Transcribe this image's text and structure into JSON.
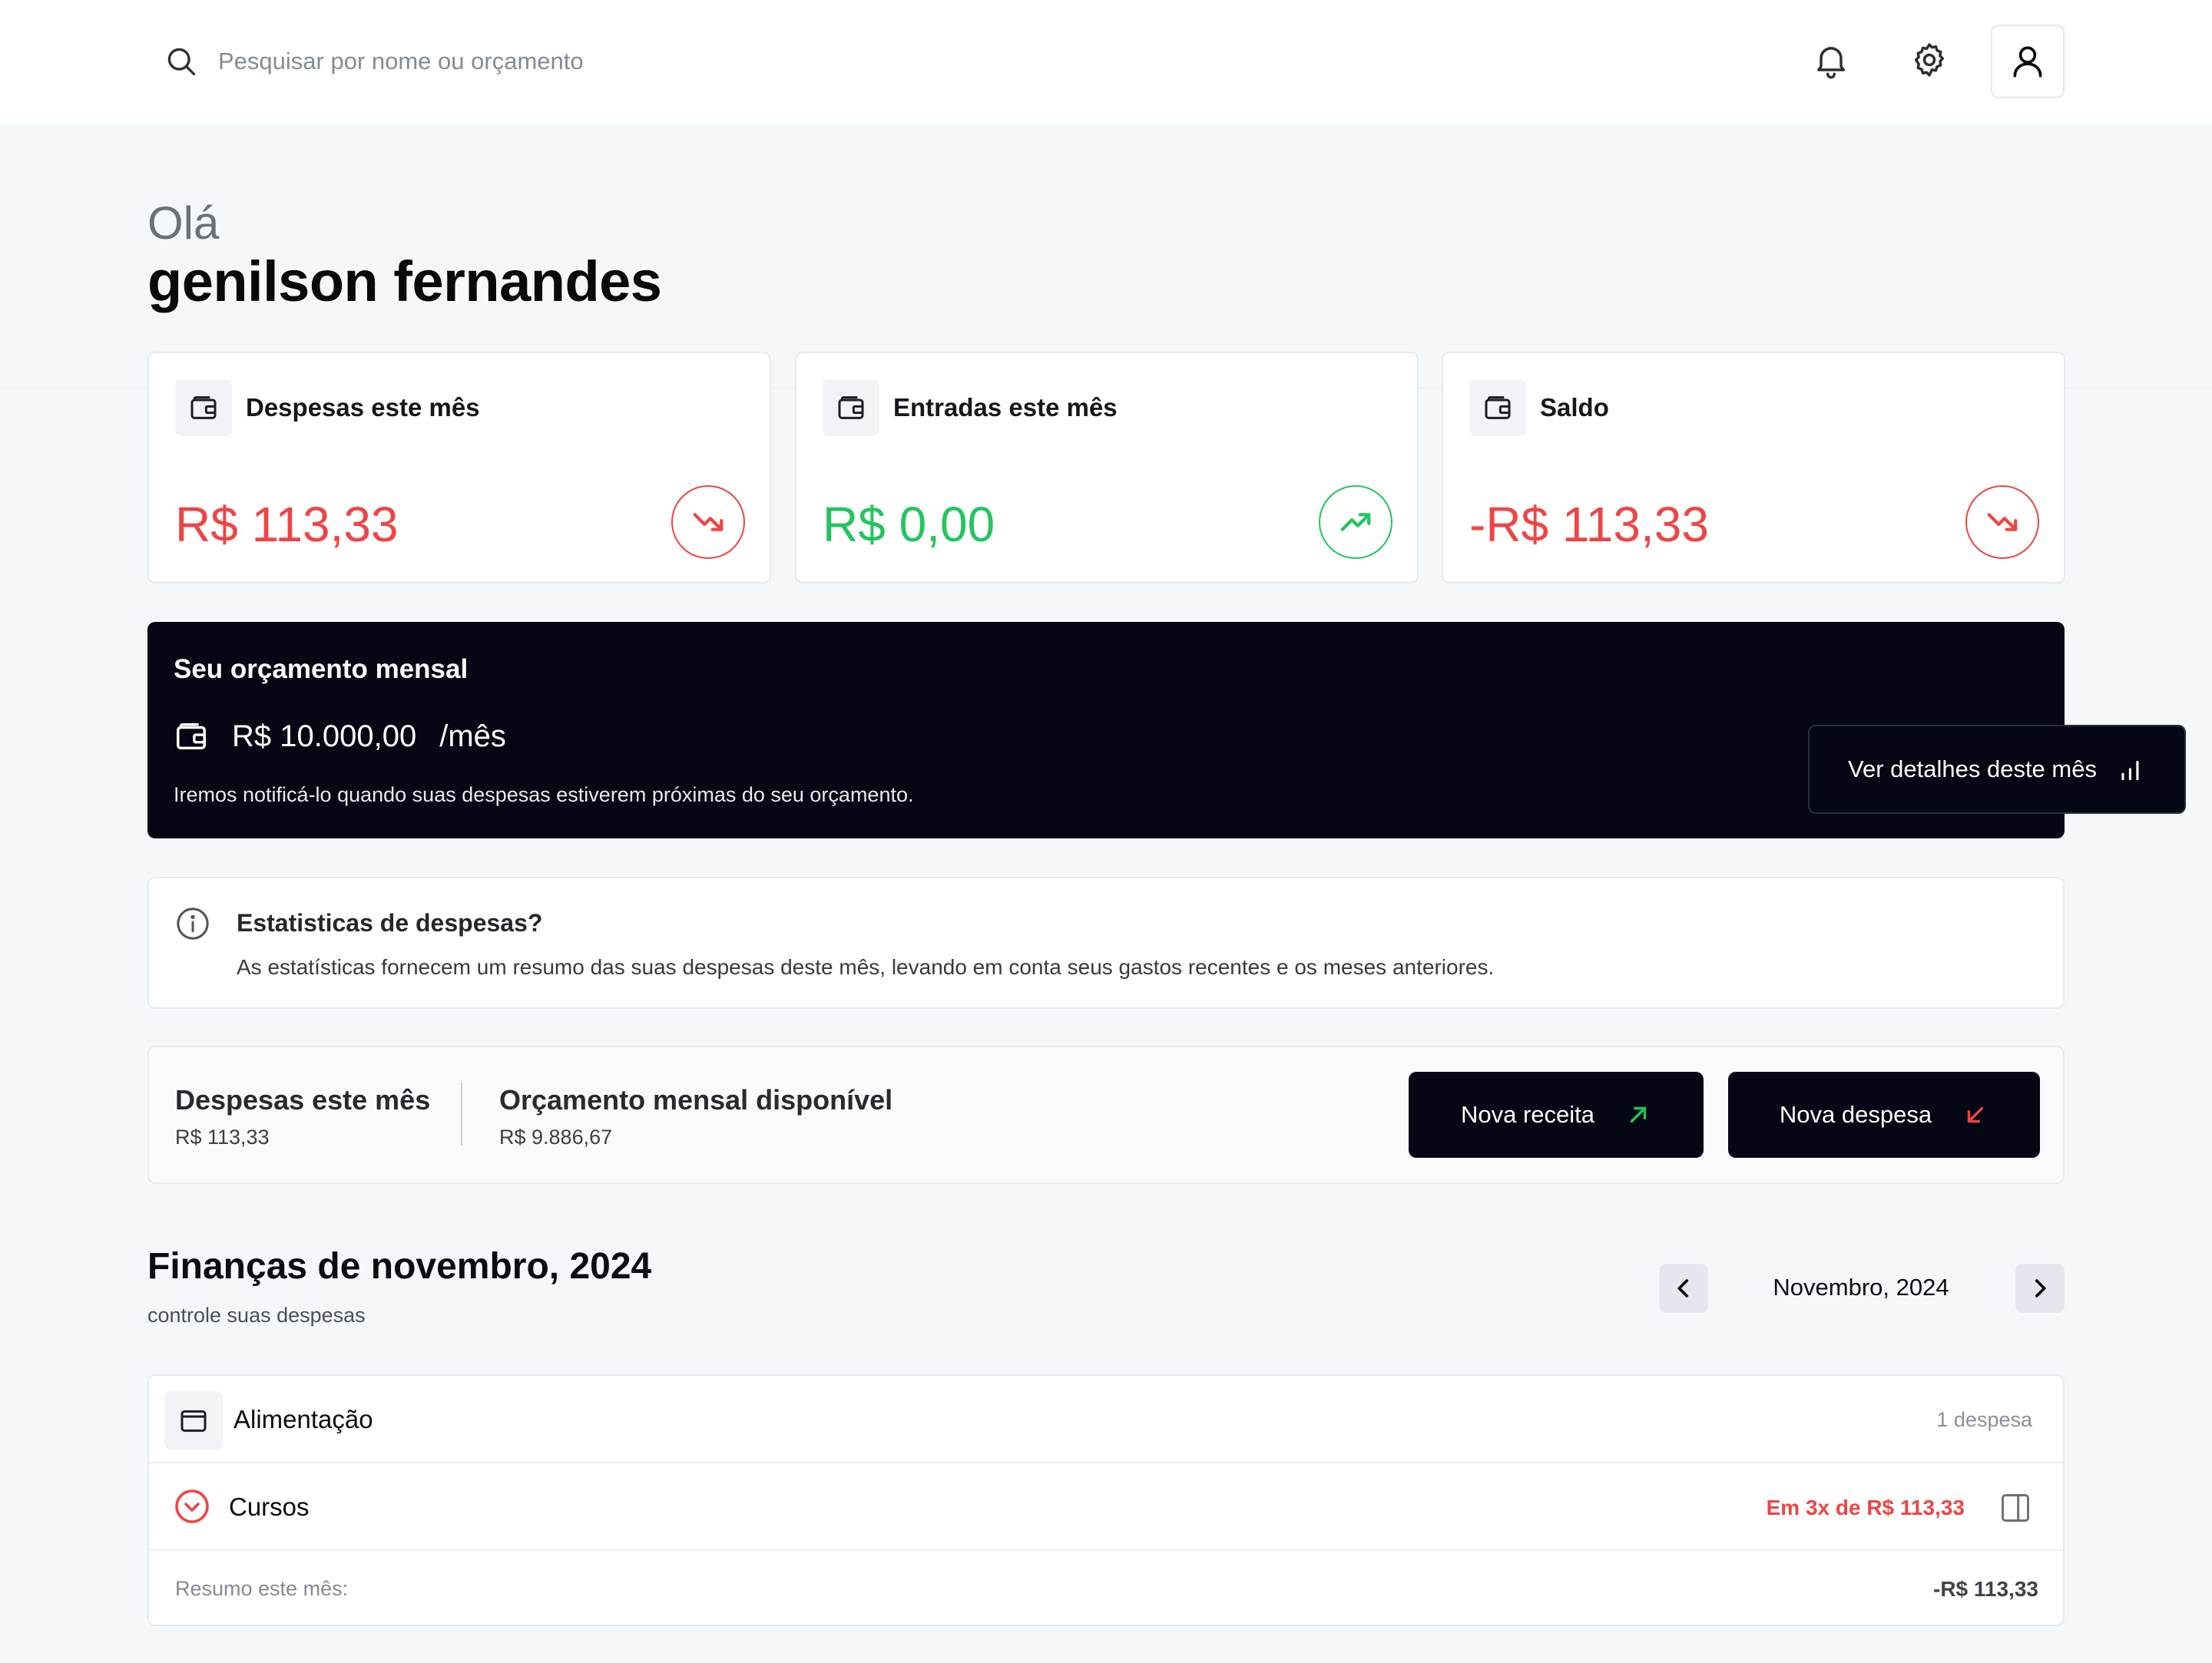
{
  "header": {
    "search_placeholder": "Pesquisar por nome ou orçamento",
    "icons": [
      "search-icon",
      "bell-icon",
      "gear-icon",
      "user-icon"
    ]
  },
  "greeting": {
    "hello": "Olá",
    "user_name": "genilson fernandes"
  },
  "cards": [
    {
      "title": "Despesas este mês",
      "amount": "R$ 113,33",
      "trend": "down",
      "color": "#ef4444"
    },
    {
      "title": "Entradas este mês",
      "amount": "R$ 0,00",
      "trend": "up",
      "color": "#22c55e"
    },
    {
      "title": "Saldo",
      "amount": "-R$ 113,33",
      "trend": "down",
      "color": "#ef4444"
    }
  ],
  "budget": {
    "title": "Seu orçamento mensal",
    "amount": "R$ 10.000,00",
    "unit": "/mês",
    "note": "Iremos notificá-lo quando suas despesas estiverem próximas do seu orçamento.",
    "details_button": "Ver detalhes deste mês"
  },
  "info": {
    "title": "Estatisticas de despesas?",
    "text": "As estatísticas fornecem um resumo das suas despesas deste mês, levando em conta seus gastos recentes e os meses anteriores."
  },
  "summary": {
    "expenses_label": "Despesas este mês",
    "expenses_value": "R$ 113,33",
    "available_label": "Orçamento mensal disponível",
    "available_value": "R$ 9.886,67",
    "new_income_button": "Nova receita",
    "new_expense_button": "Nova despesa"
  },
  "finances": {
    "title": "Finanças de novembro, 2024",
    "subtitle": "controle suas despesas",
    "month_label": "Novembro, 2024",
    "category": {
      "name": "Alimentação",
      "count": "1 despesa"
    },
    "item": {
      "name": "Cursos",
      "amount": "Em 3x de R$ 113,33"
    },
    "summary_label": "Resumo este mês:",
    "summary_value": "-R$ 113,33"
  },
  "colors": {
    "accent_dark": "#050814",
    "negative": "#ef4444",
    "positive": "#22c55e",
    "background": "#f5f8fb"
  }
}
